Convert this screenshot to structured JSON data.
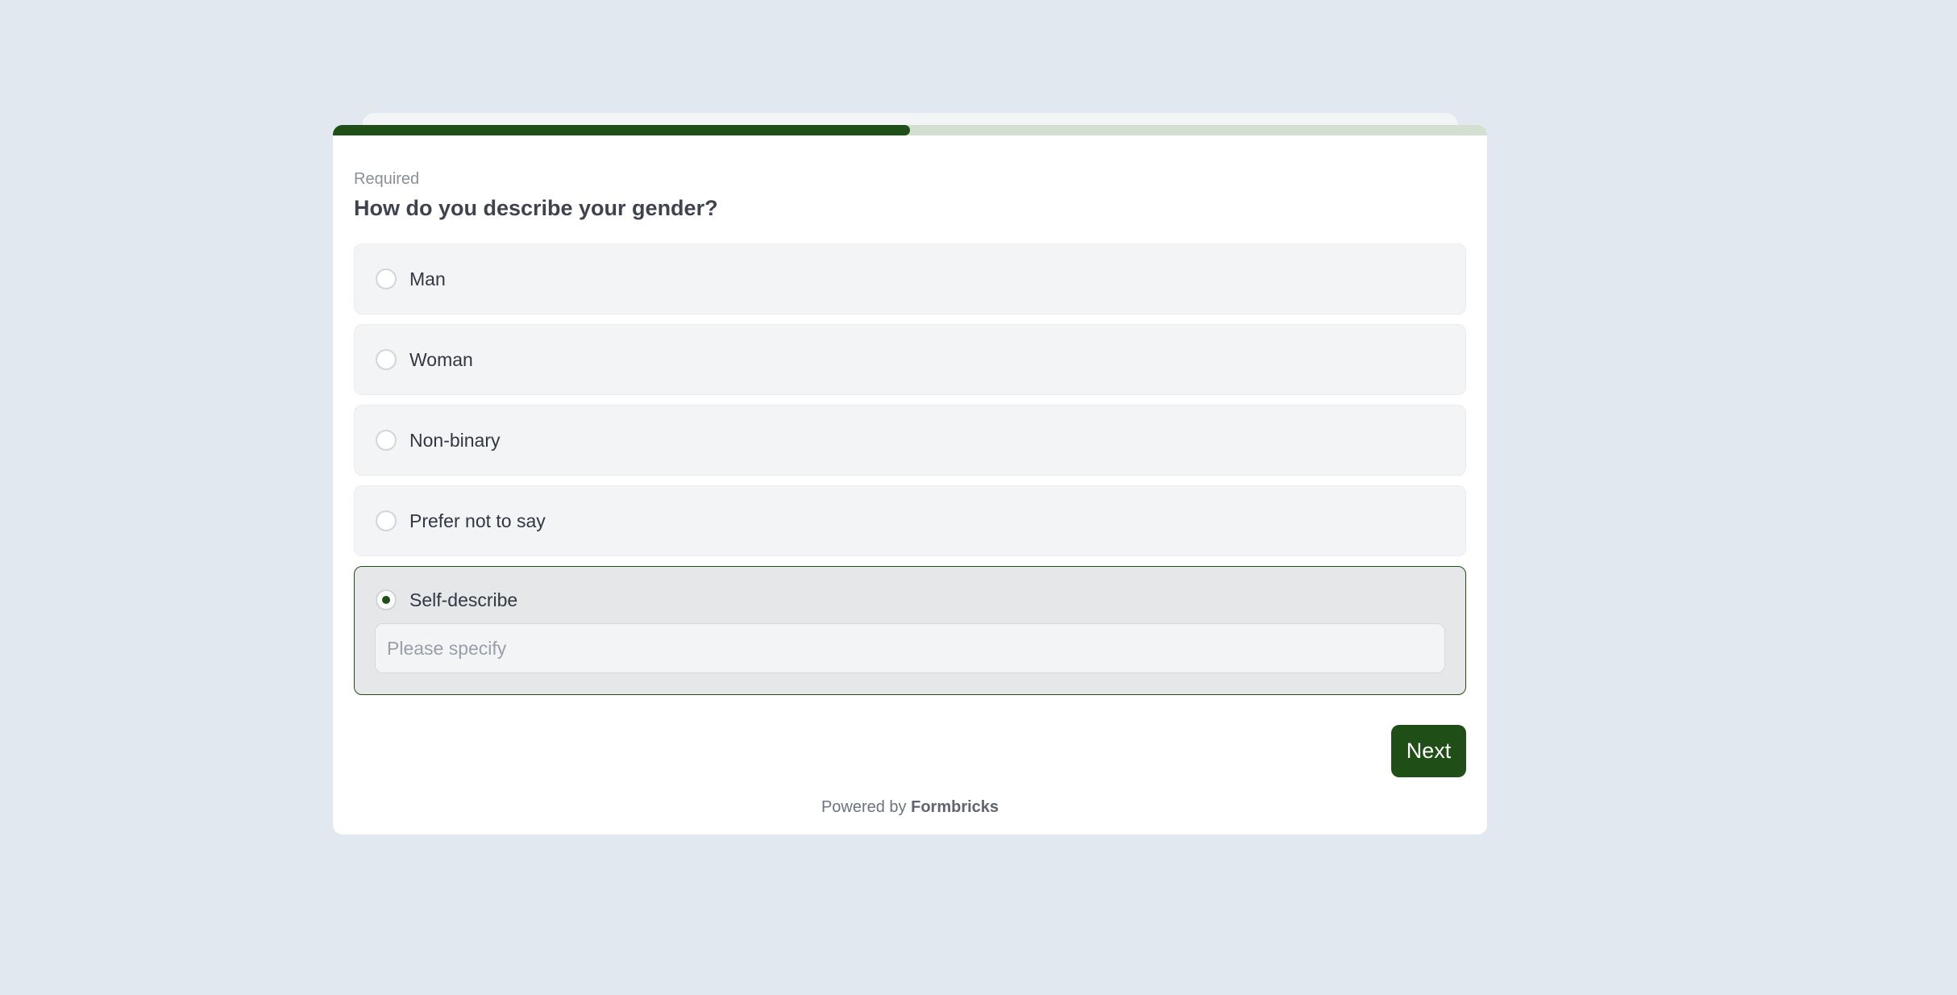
{
  "survey": {
    "progress_fraction": 0.5,
    "required_label": "Required",
    "question": "How do you describe your gender?",
    "options": [
      {
        "label": "Man",
        "selected": false
      },
      {
        "label": "Woman",
        "selected": false
      },
      {
        "label": "Non-binary",
        "selected": false
      },
      {
        "label": "Prefer not to say",
        "selected": false
      },
      {
        "label": "Self-describe",
        "selected": true
      }
    ],
    "specify_placeholder": "Please specify",
    "specify_value": "",
    "next_label": "Next"
  },
  "footer": {
    "prefix": "Powered by",
    "brand": "Formbricks"
  },
  "colors": {
    "page_background": "#e2e8f0",
    "brand_green": "#1f4f17",
    "progress_track": "#d3e0d1",
    "option_background": "#f3f4f5"
  }
}
